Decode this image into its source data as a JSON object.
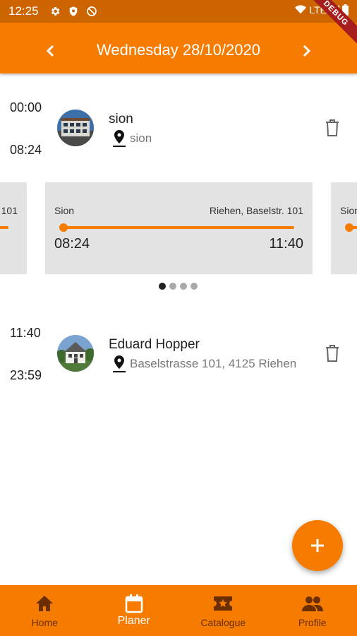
{
  "status_bar": {
    "time": "12:25",
    "network": "LTE"
  },
  "app_bar": {
    "title": "Wednesday 28/10/2020",
    "debug_label": "DEBUG"
  },
  "entries": [
    {
      "start": "00:00",
      "end": "08:24",
      "name": "sion",
      "location": "sion"
    },
    {
      "start": "11:40",
      "end": "23:59",
      "name": "Eduard Hopper",
      "location": "Baselstrasse 101, 4125 Riehen"
    }
  ],
  "trip": {
    "from": "Sion",
    "to": "Riehen, Baselstr. 101",
    "departure": "08:24",
    "arrival": "11:40",
    "prev_partial_to": "101",
    "next_partial_from": "Sion"
  },
  "carousel": {
    "page_count": 4,
    "active_index": 0
  },
  "bottom_nav": {
    "active_index": 1,
    "items": [
      {
        "label": "Home",
        "icon": "home-icon"
      },
      {
        "label": "Planer",
        "icon": "calendar-icon"
      },
      {
        "label": "Catalogue",
        "icon": "ticket-icon"
      },
      {
        "label": "Profile",
        "icon": "people-icon"
      }
    ]
  },
  "colors": {
    "primary": "#f57c00",
    "status_bar": "#cc6500",
    "card_bg": "#e3e3e4",
    "inactive_nav": "#6b2e00"
  }
}
